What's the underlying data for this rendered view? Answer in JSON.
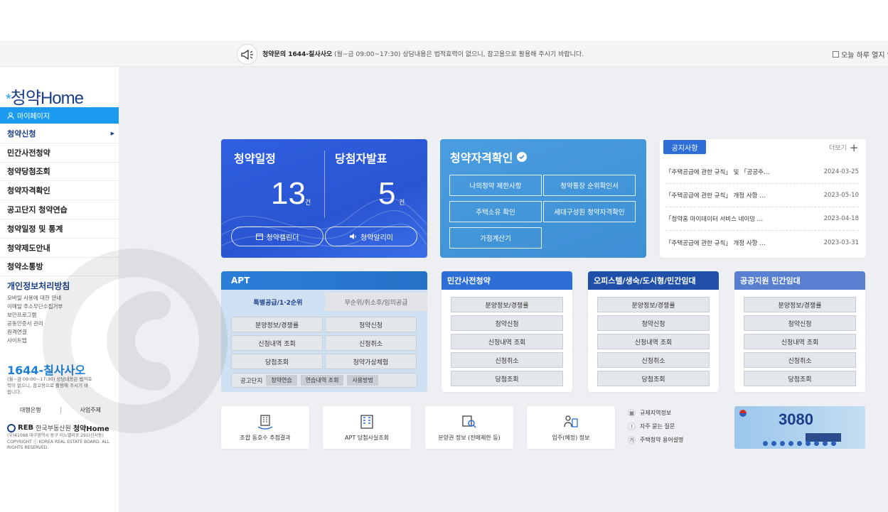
{
  "announcement": {
    "bold": "청약문의 1644-칠사사오",
    "hours": "(월~금 09:00~17:30)",
    "rest": "상담내용은 법적효력이 없으니, 참고용으로 활용해 주시기 바랍니다.",
    "today_close": "오늘 하루 열지 않"
  },
  "logo": {
    "star": "*",
    "text": "청약Home"
  },
  "sidebar": {
    "mypage": "마이페이지",
    "menu": [
      {
        "label": "청약신청"
      },
      {
        "label": "민간사전청약"
      },
      {
        "label": "청약당첨조회"
      },
      {
        "label": "청약자격확인"
      },
      {
        "label": "공고단지 청약연습"
      },
      {
        "label": "청약일정 및 통계"
      },
      {
        "label": "청약제도안내"
      },
      {
        "label": "청약소통방"
      }
    ],
    "privacy": "개인정보처리방침",
    "sublinks": [
      "모바일 사용에 대한 안내",
      "이메일 주소무단수집거부",
      "보안프로그램",
      "공동인증서 관리",
      "원격연결",
      "사이트맵"
    ],
    "phone": "1644-칠사사오",
    "phone_note": "(월~금 09:00~17:30) 상담내용은 법적효력이 없으니, 참고용으로 활용해 주시기 바랍니다.",
    "bank": "대행은행",
    "business": "사업주체",
    "reb_org": "한국부동산원",
    "reb_brand": "청약Home",
    "address": "(우)41068 대구광역시 동구 이노밸리로 291(신서동) COPYRIGHT ⓒ KOREA REAL ESTATE BOARD. ALL RIGHTS RESERVED."
  },
  "schedule": {
    "title1": "청약일정",
    "title2": "당첨자발표",
    "count1": "13",
    "count2": "5",
    "unit": "건",
    "calendar": "청약캘린더",
    "alarm": "청약알리미"
  },
  "qualification": {
    "title": "청약자격확인",
    "buttons": [
      "나의청약 제한사항",
      "청약통장 순위확인서",
      "주택소유 확인",
      "세대구성원 청약자격확인",
      "가점계산기"
    ]
  },
  "notice": {
    "tab": "공지사항",
    "more": "더보기",
    "items": [
      {
        "title": "「주택공급에 관한 규칙」 및 「공공주…",
        "date": "2024-03-25"
      },
      {
        "title": "「주택공급에 관한 규칙」 개정 사항 …",
        "date": "2023-05-10"
      },
      {
        "title": "「청약홈 마이데이터 서비스 네이밍 …",
        "date": "2023-04-18"
      },
      {
        "title": "「주택공급에 관한 규칙」 개정 사항 …",
        "date": "2023-03-31"
      }
    ]
  },
  "apt": {
    "title": "APT",
    "tab1": "특별공급/1·2순위",
    "tab2": "무순위/취소후/임의공급",
    "buttons": [
      "분양정보/경쟁률",
      "청약신청",
      "신청내역 조회",
      "신청취소",
      "당첨조회",
      "청약가상체험"
    ],
    "gonggo": "공고단지",
    "gonggo_btns": [
      "청약연습",
      "연습내역 조회",
      "사용방법"
    ]
  },
  "panels": [
    {
      "title": "민간사전청약",
      "color": "#2d6fd6",
      "buttons": [
        "분양정보/경쟁률",
        "청약신청",
        "신청내역 조회",
        "신청취소",
        "당첨조회"
      ]
    },
    {
      "title": "오피스텔/생숙/도시형/민간임대",
      "color": "#1f4fa8",
      "buttons": [
        "분양정보/경쟁률",
        "청약신청",
        "신청내역 조회",
        "신청취소",
        "당첨조회"
      ]
    },
    {
      "title": "공공지원 민간임대",
      "color": "#5a7fd0",
      "buttons": [
        "분양정보/경쟁률",
        "청약신청",
        "신청내역 조회",
        "신청취소",
        "당첨조회"
      ]
    }
  ],
  "quick": [
    {
      "label": "조합 동호수 추첨결과",
      "icon": "apartment-lottery-icon"
    },
    {
      "label": "APT 당첨사실조회",
      "icon": "building-icon"
    },
    {
      "label": "분양권 정보 (전매제한 등)",
      "icon": "document-search-icon"
    },
    {
      "label": "입주(예정) 정보",
      "icon": "person-building-icon"
    }
  ],
  "quick_links": [
    {
      "label": "규제지역정보",
      "icon": "map-icon",
      "glyph": "▦"
    },
    {
      "label": "자주 묻는 질문",
      "icon": "exclamation-icon",
      "glyph": "!"
    },
    {
      "label": "주택청약 용어설명",
      "icon": "dictionary-icon",
      "glyph": "가"
    }
  ],
  "banner": {
    "big": "3080"
  }
}
